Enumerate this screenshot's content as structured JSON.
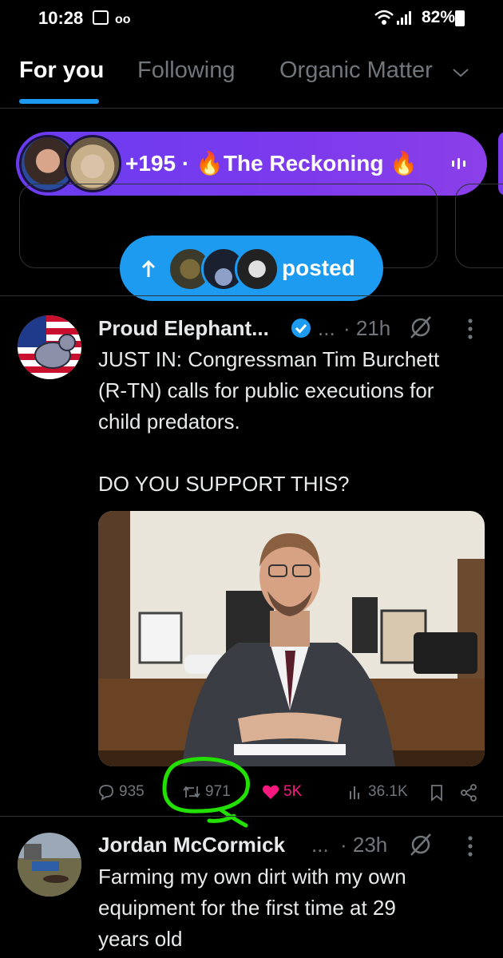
{
  "status": {
    "time": "10:28",
    "battery": "82%"
  },
  "tabs": [
    {
      "label": "For you",
      "active": true
    },
    {
      "label": "Following",
      "active": false
    },
    {
      "label": "Organic Matter",
      "active": false
    }
  ],
  "space": {
    "text": "+195 · 🔥The Reckoning 🔥"
  },
  "new_posts": {
    "label": "posted"
  },
  "tweets": [
    {
      "author": "Proud Elephant...",
      "handle_ellipsis": "...",
      "time": "· 21h",
      "text_lines": [
        "JUST IN: Congressman Tim Burchett",
        "(R-TN) calls for public executions for",
        "child predators.",
        "",
        "DO YOU SUPPORT THIS?"
      ],
      "replies": "935",
      "reposts": "971",
      "likes": "5K",
      "views": "36.1K"
    },
    {
      "author": "Jordan McCormick",
      "handle_ellipsis": "...",
      "time": "· 23h",
      "text_lines": [
        "Farming my own dirt with my own",
        "equipment for the first time at 29",
        "years old"
      ]
    }
  ],
  "colors": {
    "accent": "#1d9bf0",
    "space": "#7c3aed",
    "like": "#f91880",
    "annotation": "#22e000"
  }
}
